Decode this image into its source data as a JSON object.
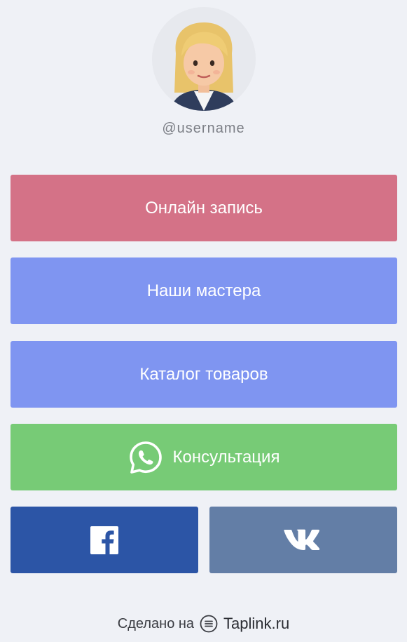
{
  "profile": {
    "username": "@username",
    "avatar_icon": "woman-emoji-avatar"
  },
  "buttons": [
    {
      "label": "Онлайн запись",
      "color": "#d47287"
    },
    {
      "label": "Наши мастера",
      "color": "#7f95f1"
    },
    {
      "label": "Каталог товаров",
      "color": "#7f95f1"
    },
    {
      "label": "Консультация",
      "color": "#77cb76",
      "icon": "whatsapp-icon"
    }
  ],
  "social": [
    {
      "name": "facebook",
      "icon": "facebook-icon",
      "color": "#2c55a6"
    },
    {
      "name": "vk",
      "icon": "vk-icon",
      "color": "#637ea6"
    }
  ],
  "footer": {
    "made_with": "Сделано на",
    "brand": "Taplink.ru",
    "icon": "taplink-logo-icon"
  }
}
